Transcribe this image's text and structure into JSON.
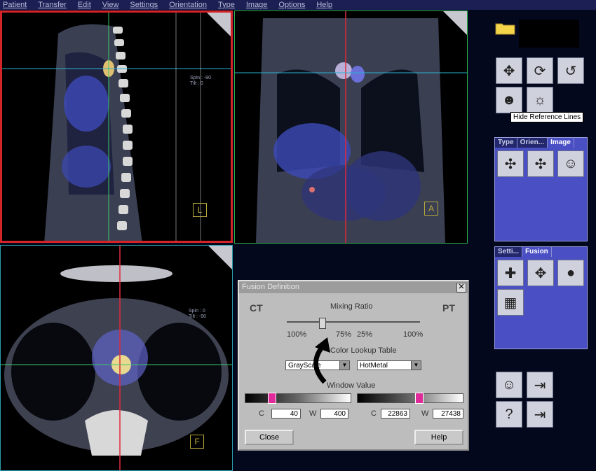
{
  "menu": [
    "Patient",
    "Transfer",
    "Edit",
    "View",
    "Settings",
    "Orientation",
    "Type",
    "Image",
    "Options",
    "Help"
  ],
  "viewports": {
    "sagittal": {
      "label": "L",
      "spin_tilt": [
        "Spin : -90",
        "Tilt : 0"
      ]
    },
    "coronal": {
      "label": "A"
    },
    "axial": {
      "label": "F",
      "spin_tilt": [
        "Spin : 0",
        "Tilt : -90"
      ]
    }
  },
  "tools": {
    "tooltip": "Hide Reference Lines"
  },
  "type_panel": {
    "tabs": [
      "Type",
      "Orien...",
      "Image"
    ]
  },
  "fusion_panel": {
    "tabs": [
      "Setti...",
      "Fusion"
    ]
  },
  "fusion_dialog": {
    "title": "Fusion Definition",
    "close_glyph": "✕",
    "left_modality": "CT",
    "right_modality": "PT",
    "mixing_ratio_label": "Mixing Ratio",
    "ratio_labels": [
      "100%",
      "75%",
      "25%",
      "100%"
    ],
    "lut_label": "Color Lookup Table",
    "ct_lut": "GrayScale",
    "pt_lut": "HotMetal",
    "window_label": "Window Value",
    "ct_c_label": "C",
    "ct_c": "40",
    "ct_w_label": "W",
    "ct_w": "400",
    "pt_c_label": "C",
    "pt_c": "22863",
    "pt_w_label": "W",
    "pt_w": "27438",
    "close_button": "Close",
    "help_button": "Help",
    "mixing_ratio": 0.25
  },
  "colors": {
    "accent": "#4a4fc4",
    "sagittal_border": "#d4242a",
    "coronal_border": "#2db34a",
    "axial_border": "#2a9fb0",
    "window_marker": "#e02a9a"
  }
}
